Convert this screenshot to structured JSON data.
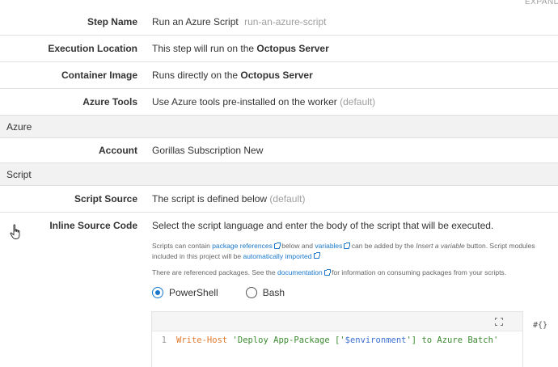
{
  "header": {
    "expand_all": "EXPAND A"
  },
  "rows": {
    "step_name": {
      "label": "Step Name",
      "value": "Run an Azure Script",
      "slug": "run-an-azure-script"
    },
    "execution_location": {
      "label": "Execution Location",
      "prefix": "This step will run on the",
      "server": "Octopus Server"
    },
    "container_image": {
      "label": "Container Image",
      "prefix": "Runs directly on the",
      "server": "Octopus Server"
    },
    "azure_tools": {
      "label": "Azure Tools",
      "value": "Use Azure tools pre-installed on the worker",
      "suffix": "(default)"
    },
    "account": {
      "label": "Account",
      "value": "Gorillas Subscription New"
    },
    "script_source": {
      "label": "Script Source",
      "value": "The script is defined below",
      "suffix": "(default)"
    },
    "inline_source": {
      "label": "Inline Source Code",
      "value": "Select the script language and enter the body of the script that will be executed."
    }
  },
  "sections": {
    "azure": "Azure",
    "script": "Script"
  },
  "help": {
    "p1_a": "Scripts can contain",
    "link_package_refs": "package references",
    "p1_b": "below and",
    "link_variables": "variables",
    "p1_c": "can be added by the",
    "insert_variable": "Insert a variable",
    "p1_d": "button. Script modules",
    "p1_e": "included in this project will be",
    "link_auto_imported": "automatically imported",
    "p2_a": "There are referenced packages. See the",
    "link_documentation": "documentation",
    "p2_b": "for information on consuming packages from your scripts."
  },
  "languages": {
    "selected": "PowerShell",
    "options": [
      "PowerShell",
      "Bash"
    ]
  },
  "editor": {
    "line_number": "1",
    "code_cmd": "Write-Host",
    "code_str_a": "'Deploy App-Package ['",
    "code_var": "$environment",
    "code_str_b": "'] to Azure Batch'",
    "insert_variable_icon": "#{}"
  },
  "icons": {
    "fullscreen": "expand-icon",
    "external": "external-link-icon",
    "cursor": "hand-cursor-icon"
  },
  "colors": {
    "link": "#1a77ca",
    "section_bg": "#f2f2f2",
    "keyword": "#e07a2e",
    "string": "#3d8a32",
    "variable": "#3b6fd0"
  }
}
